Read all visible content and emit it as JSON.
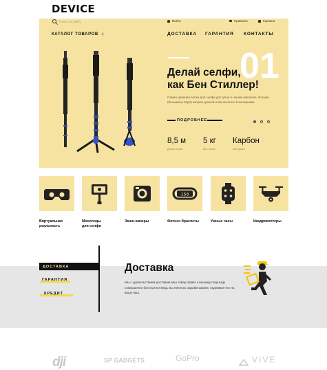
{
  "header": {
    "logo": "DEVICE",
    "search_placeholder": "Поиск по сайту",
    "login": "Войти",
    "compare": "Сравнить",
    "cart": "Корзина",
    "catalog": "КАТАЛОГ ТОВАРОВ",
    "catalog_plus": "+",
    "nav": [
      "ДОСТАВКА",
      "ГАРАНТИЯ",
      "КОНТАКТЫ"
    ]
  },
  "hero": {
    "number": "01",
    "headline_1": "Делай селфи,",
    "headline_2": "как Бен Стиллер!",
    "description": "Самая длинная палка для селфи доступна в нашем магазине. Возьми (Возьмёшь Карл) метров длиной и веcом всего 5 килограмм.",
    "more": "ПОДРОБНЕЕ",
    "slides": 3,
    "active_slide": 1,
    "stats": [
      {
        "value": "8,5 м",
        "label": "Длина палки"
      },
      {
        "value": "5 кг",
        "label": "Вес палки"
      },
      {
        "value": "Карбон",
        "label": "Материал"
      }
    ]
  },
  "categories": [
    {
      "label_1": "Виртуальная",
      "label_2": "реальность",
      "icon": "vr-headset-icon"
    },
    {
      "label_1": "Моноподы",
      "label_2": "для селфи",
      "icon": "monopod-phone-icon"
    },
    {
      "label_1": "Экшн-камеры",
      "label_2": "",
      "icon": "action-camera-icon"
    },
    {
      "label_1": "Фитнес-браслеты",
      "label_2": "",
      "icon": "fitness-band-icon"
    },
    {
      "label_1": "Умные часы",
      "label_2": "",
      "icon": "smartwatch-icon"
    },
    {
      "label_1": "Квадрокоптеры",
      "label_2": "",
      "icon": "drone-icon"
    }
  ],
  "fitness_display": "150",
  "services": {
    "tabs": [
      "ДОСТАВКА",
      "ГАРАНТИЯ",
      "КРЕДИТ"
    ],
    "title": "Доставка",
    "text": "Мы с удовольствием доставим ваш товар прямо к вашему подъезду совершенно бесплатно! Ведь мы неплохо зарабатываем, поднимая его на вашу наш."
  },
  "brands": [
    "dji",
    "SP GADGETS",
    "GoPro",
    "VIVE"
  ],
  "colors": {
    "accent": "#f6e3a2",
    "highlight": "#f5d94c",
    "dark": "#111111",
    "band": "#e6e6e6"
  }
}
